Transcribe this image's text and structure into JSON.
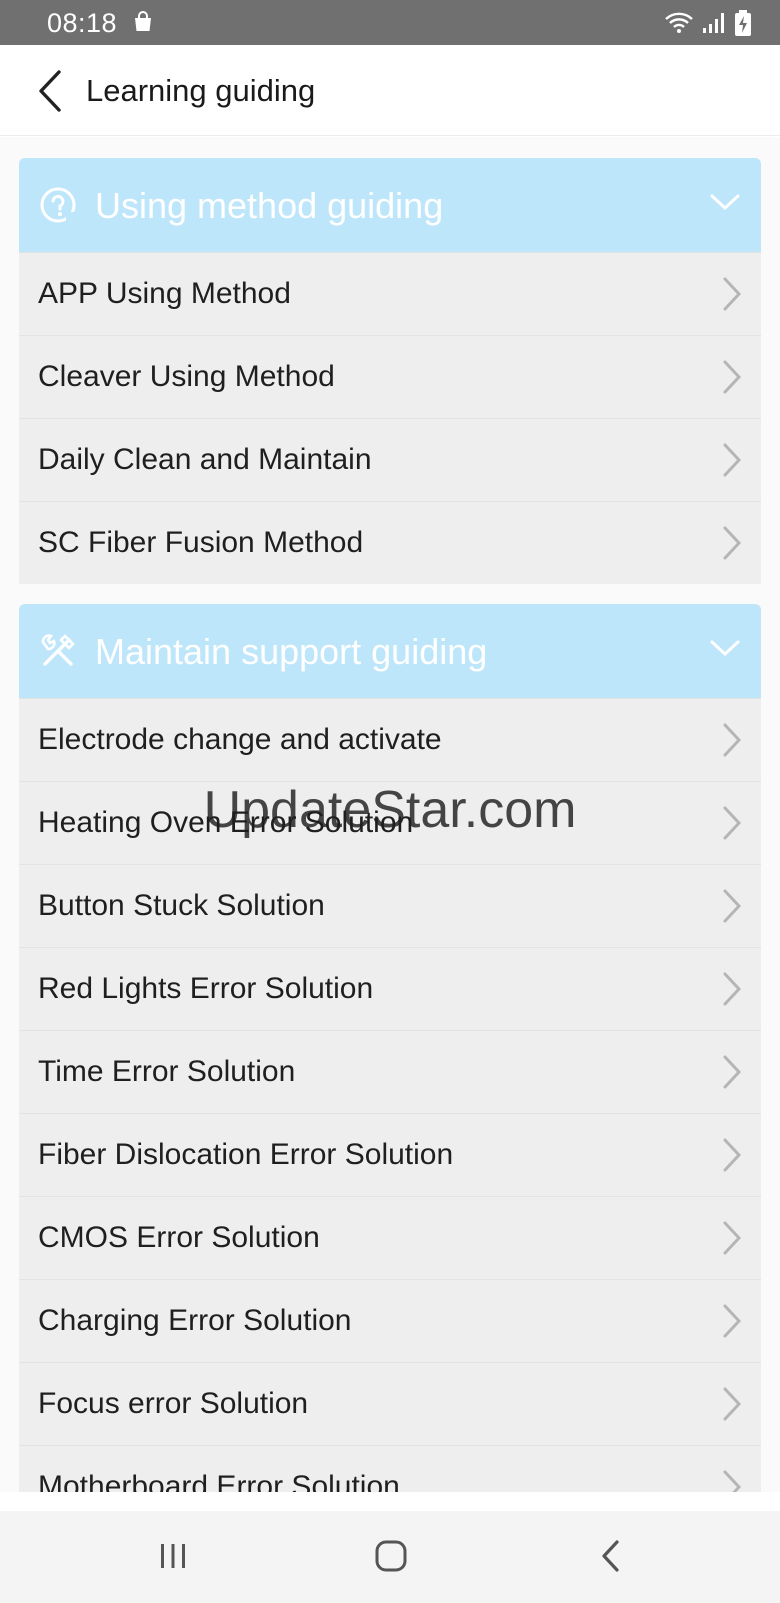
{
  "status_bar": {
    "time": "08:18",
    "icons": [
      "shopping-bag-icon",
      "wifi-icon",
      "signal-icon",
      "battery-charging-icon"
    ]
  },
  "app_bar": {
    "title": "Learning guiding",
    "back_icon": "back-arrow-icon"
  },
  "sections": [
    {
      "title": "Using method guiding",
      "icon": "guide-icon",
      "items": [
        "APP Using Method",
        "Cleaver Using Method",
        "Daily Clean and Maintain",
        "SC Fiber Fusion Method"
      ]
    },
    {
      "title": "Maintain support guiding",
      "icon": "tools-icon",
      "items": [
        "Electrode change and activate",
        "Heating Oven Error Solution",
        "Button Stuck Solution",
        "Red Lights Error Solution",
        "Time Error Solution",
        "Fiber Dislocation Error Solution",
        "CMOS Error Solution",
        "Charging Error Solution",
        "Focus error Solution",
        "Motherboard Error Solution"
      ]
    }
  ],
  "watermark": "UpdateStar.com",
  "nav_bar": {
    "icons": [
      "recent-apps-icon",
      "home-icon",
      "back-icon"
    ]
  },
  "colors": {
    "status_bar": "#707070",
    "section_header": "#bee6fb",
    "row_bg": "#eeeeee",
    "arrow": "#b5b5b5"
  }
}
